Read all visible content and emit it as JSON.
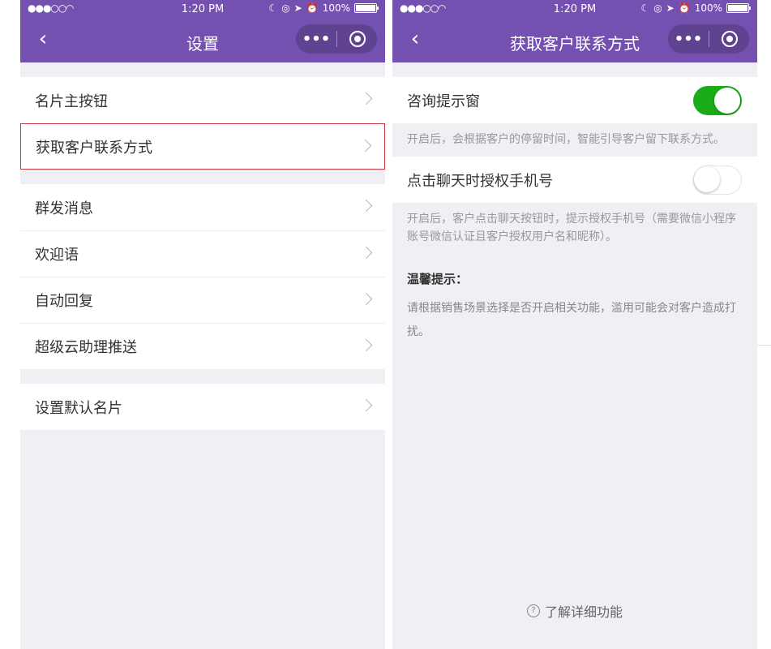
{
  "status_bar": {
    "time": "1:20 PM",
    "battery": "100%",
    "signal": "●●●○○",
    "wifi": "◠"
  },
  "left": {
    "title": "设置",
    "groups": [
      [
        "名片主按钮",
        "获取客户联系方式"
      ],
      [
        "群发消息",
        "欢迎语",
        "自动回复",
        "超级云助理推送"
      ],
      [
        "设置默认名片"
      ]
    ]
  },
  "right": {
    "title": "获取客户联系方式",
    "switches": [
      {
        "label": "咨询提示窗",
        "on": true,
        "desc": "开启后，会根据客户的停留时间，智能引导客户留下联系方式。"
      },
      {
        "label": "点击聊天时授权手机号",
        "on": false,
        "desc": "开启后，客户点击聊天按钮时，提示授权手机号（需要微信小程序账号微信认证且客户授权用户名和昵称）。"
      }
    ],
    "tips_title": "温馨提示：",
    "tips_text": "请根据销售场景选择是否开启相关功能，滥用可能会对客户造成打扰。",
    "learn_more": "了解详细功能"
  },
  "colors": {
    "header": "#7451b0",
    "switch_on": "#1aad19",
    "highlight_border": "#c0393b"
  },
  "icons": {
    "back": "chevron-left-icon",
    "more": "more-dots-icon",
    "close": "target-circle-icon",
    "row_arrow": "chevron-right-icon",
    "help": "question-circle-icon"
  }
}
